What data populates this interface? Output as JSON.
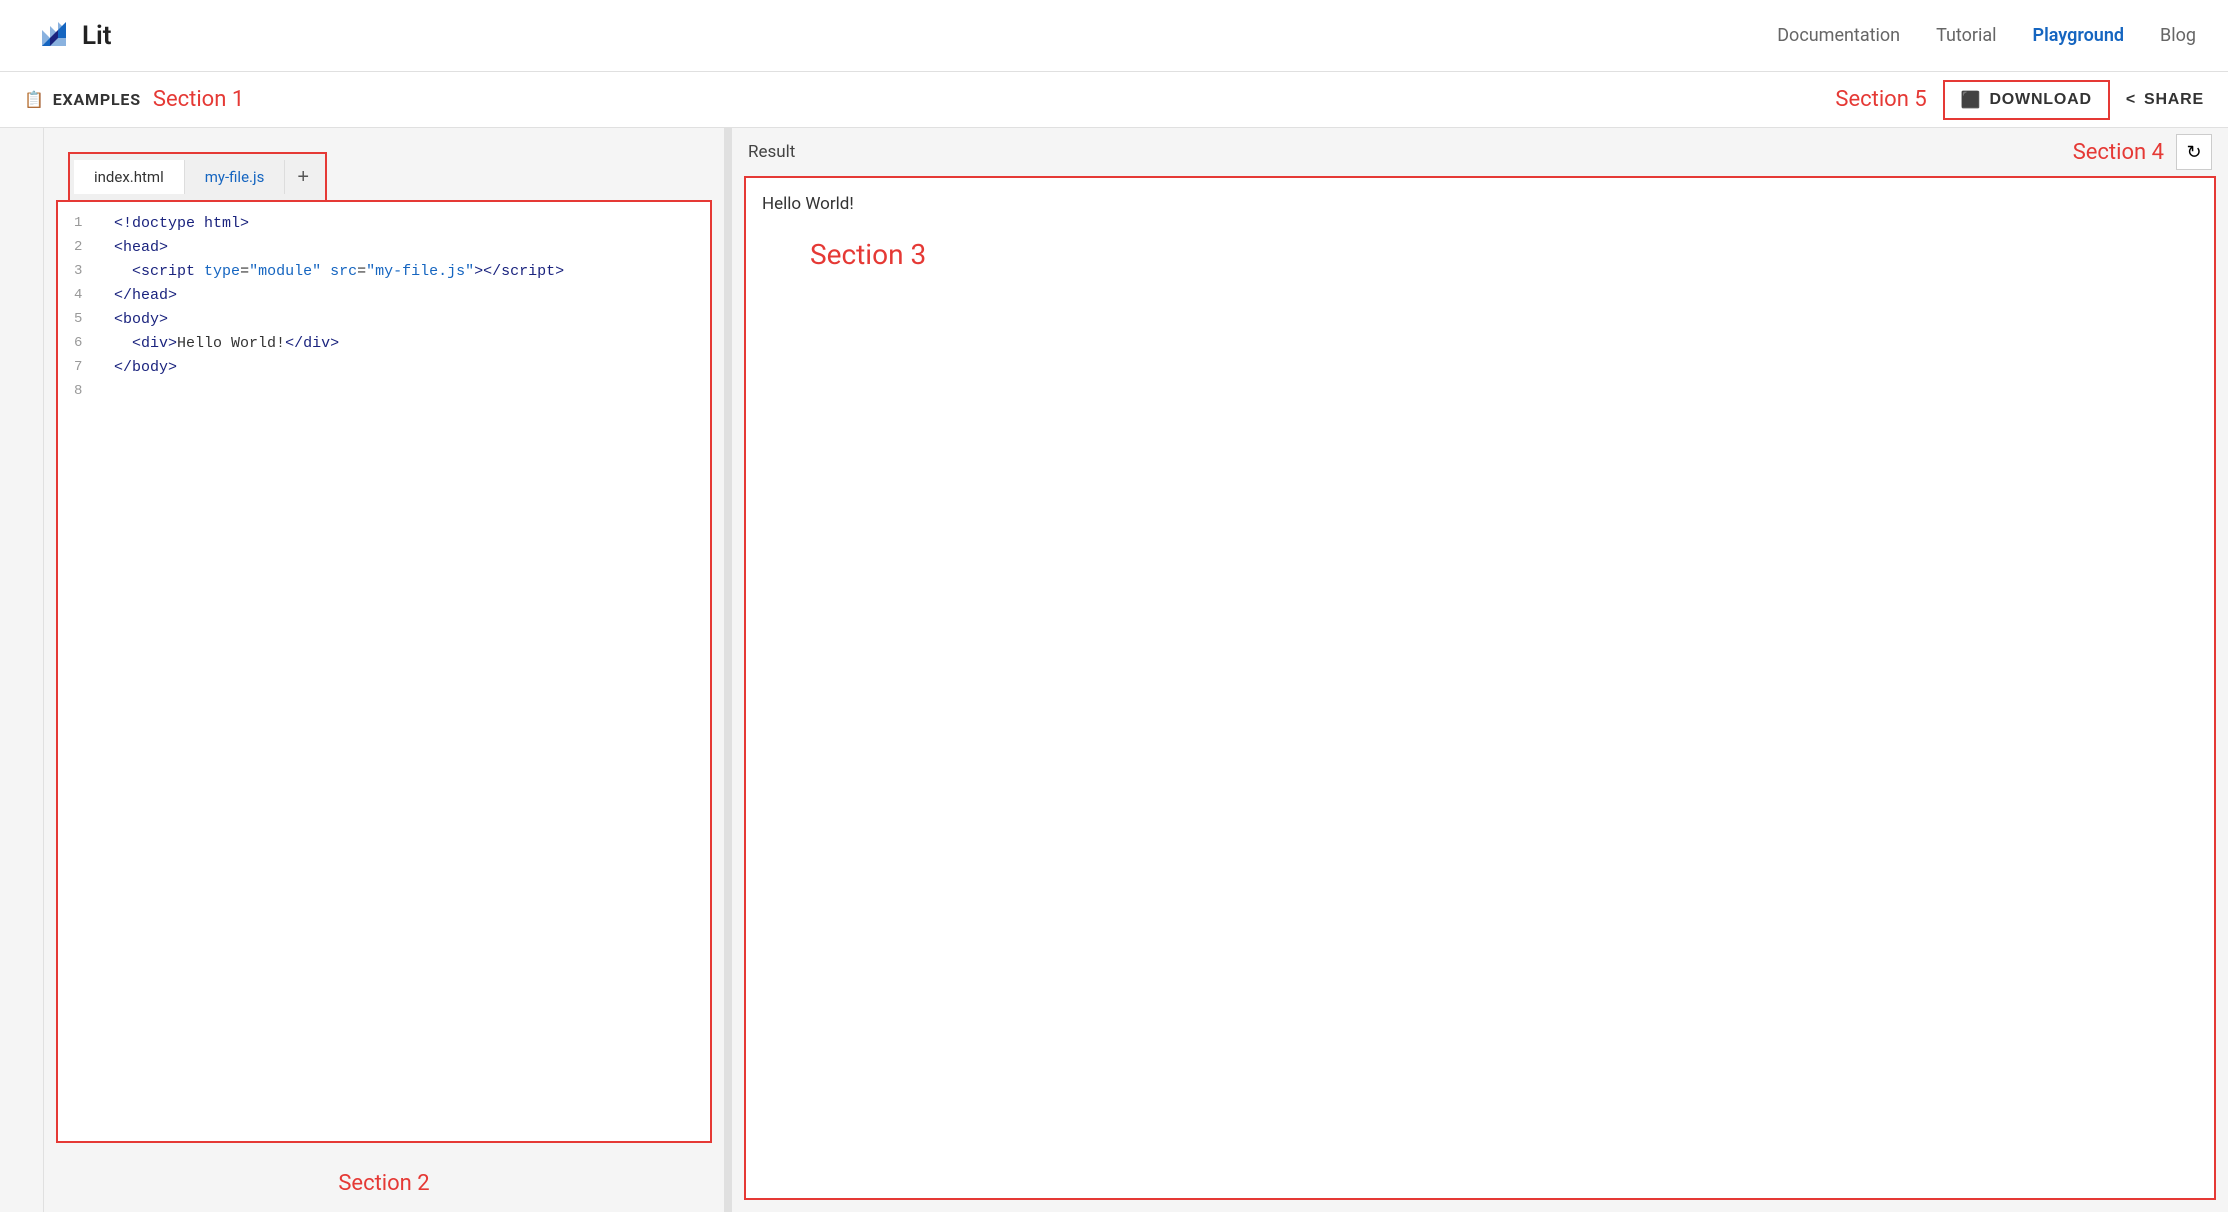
{
  "nav": {
    "logo_text": "Lit",
    "links": [
      {
        "label": "Documentation",
        "active": false
      },
      {
        "label": "Tutorial",
        "active": false
      },
      {
        "label": "Playground",
        "active": true
      },
      {
        "label": "Blog",
        "active": false
      }
    ]
  },
  "second_bar": {
    "examples_icon": "📋",
    "examples_label": "EXAMPLES",
    "section1_label": "Section 1",
    "section5_label": "Section 5",
    "download_label": "DOWNLOAD",
    "share_label": "SHARE"
  },
  "tabs": [
    {
      "label": "index.html",
      "active": true
    },
    {
      "label": "my-file.js",
      "active": false
    }
  ],
  "tab_add": "+",
  "code_lines": [
    {
      "num": "1",
      "html": "<span class='code-tag'>&lt;!doctype html&gt;</span>"
    },
    {
      "num": "2",
      "html": "<span class='code-tag'>&lt;head&gt;</span>"
    },
    {
      "num": "3",
      "html": "  <span class='code-tag'>&lt;script</span> <span class='code-attr'>type</span>=<span class='code-val'>\"module\"</span> <span class='code-attr'>src</span>=<span class='code-val'>\"my-file.js\"</span><span class='code-tag'>&gt;&lt;/script&gt;</span>"
    },
    {
      "num": "4",
      "html": "<span class='code-tag'>&lt;/head&gt;</span>"
    },
    {
      "num": "5",
      "html": "<span class='code-tag'>&lt;body&gt;</span>"
    },
    {
      "num": "6",
      "html": "  <span class='code-tag'>&lt;div&gt;</span>Hello World!<span class='code-tag'>&lt;/div&gt;</span>"
    },
    {
      "num": "7",
      "html": "<span class='code-tag'>&lt;/body&gt;</span>"
    },
    {
      "num": "8",
      "html": ""
    }
  ],
  "section2_label": "Section 2",
  "result": {
    "label": "Result",
    "section4_label": "Section 4",
    "hello_text": "Hello World!",
    "section3_label": "Section 3"
  }
}
